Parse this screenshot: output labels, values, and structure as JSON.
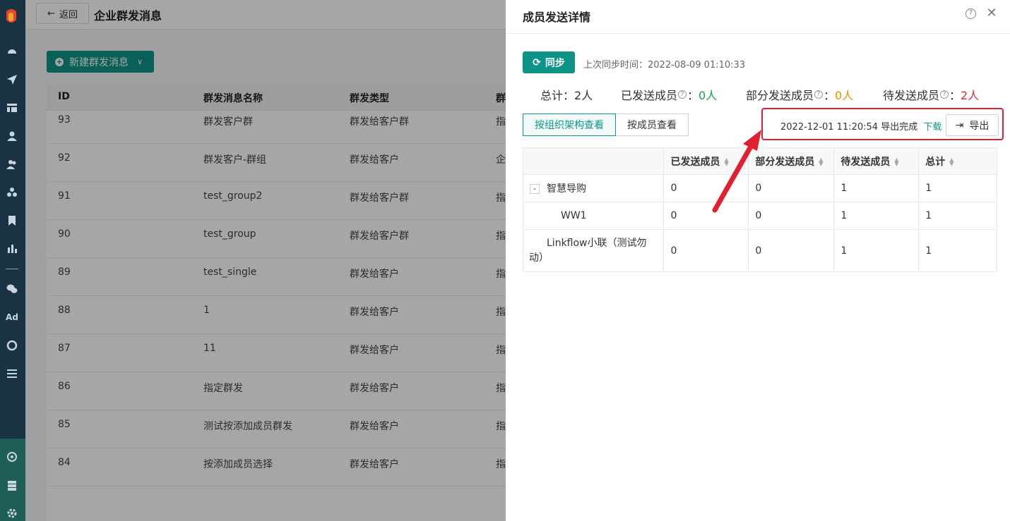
{
  "nav": {
    "icons": [
      "dashboard-icon",
      "send-icon",
      "layout-icon",
      "user-icon",
      "users-icon",
      "group-icon",
      "bookmark-icon",
      "bar-chart-icon",
      "wechat-icon",
      "ad-icon",
      "analytics-icon",
      "list-icon",
      "team-icon",
      "server-icon",
      "settings-icon"
    ],
    "ad_label": "Ad"
  },
  "topbar": {
    "back_label": "返回",
    "title": "企业群发消息"
  },
  "main": {
    "new_button_label": "新建群发消息",
    "columns": [
      "ID",
      "群发消息名称",
      "群发类型",
      "群"
    ],
    "rows": [
      {
        "id": "93",
        "name": "群发客户群",
        "type": "群发给客户群",
        "extra": "指"
      },
      {
        "id": "92",
        "name": "群发客户-群组",
        "type": "群发给客户",
        "extra": "企"
      },
      {
        "id": "91",
        "name": "test_group2",
        "type": "群发给客户群",
        "extra": "指"
      },
      {
        "id": "90",
        "name": "test_group",
        "type": "群发给客户群",
        "extra": "指"
      },
      {
        "id": "89",
        "name": "test_single",
        "type": "群发给客户",
        "extra": "指"
      },
      {
        "id": "88",
        "name": "1",
        "type": "群发给客户",
        "extra": "指"
      },
      {
        "id": "87",
        "name": "11",
        "type": "群发给客户",
        "extra": "指"
      },
      {
        "id": "86",
        "name": "指定群发",
        "type": "群发给客户",
        "extra": "指"
      },
      {
        "id": "85",
        "name": "测试按添加成员群发",
        "type": "群发给客户",
        "extra": "指"
      },
      {
        "id": "84",
        "name": "按添加成员选择",
        "type": "群发给客户",
        "extra": "指"
      }
    ]
  },
  "drawer": {
    "title": "成员发送详情",
    "sync_label": "同步",
    "sync_time_label": "上次同步时间：2022-08-09 01:10:33",
    "stats": {
      "total_label": "总计：",
      "total_value": "2人",
      "sent_label": "已发送成员",
      "sent_value": "0人",
      "partial_label": "部分发送成员",
      "partial_value": "0人",
      "pending_label": "待发送成员",
      "pending_value": "2人",
      "colon": "："
    },
    "view_tabs": [
      "按组织架构查看",
      "按成员查看"
    ],
    "export_info": "2022-12-01 11:20:54 导出完成",
    "download_label": "下载",
    "export_label": "导出",
    "table": {
      "headers": [
        "",
        "已发送成员",
        "部分发送成员",
        "待发送成员",
        "总计"
      ],
      "rows": [
        {
          "name": "智慧导购",
          "expand": "-",
          "sent": "0",
          "partial": "0",
          "pending": "1",
          "total": "1"
        },
        {
          "name": "WW1",
          "sent": "0",
          "partial": "0",
          "pending": "1",
          "total": "1"
        },
        {
          "name": "Linkflow小联（测试勿动）",
          "sent": "0",
          "partial": "0",
          "pending": "1",
          "total": "1"
        }
      ]
    },
    "colors": {
      "accent": "#0d9486",
      "highlight": "#e0202e",
      "sent": "#17a34a",
      "partial": "#f08c00",
      "pending": "#e03131"
    }
  }
}
